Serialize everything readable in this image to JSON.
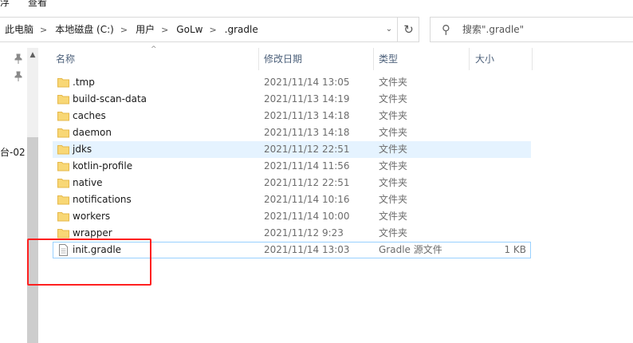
{
  "ribbon": {
    "items": [
      "浮",
      "查看"
    ]
  },
  "address_bar": {
    "crumbs": [
      "此电脑",
      "本地磁盘 (C:)",
      "用户",
      "GoLw",
      ".gradle"
    ],
    "separator": ">",
    "dropdown_glyph": "⌄",
    "refresh_glyph": "↻"
  },
  "search": {
    "placeholder": "搜索\".gradle\""
  },
  "nav_pane": {
    "partial_label": "台-02"
  },
  "columns": {
    "name": "名称",
    "date": "修改日期",
    "type": "类型",
    "size": "大小"
  },
  "files": [
    {
      "name": ".tmp",
      "date": "2021/11/14 13:05",
      "type": "文件夹",
      "size": "",
      "kind": "folder"
    },
    {
      "name": "build-scan-data",
      "date": "2021/11/13 14:19",
      "type": "文件夹",
      "size": "",
      "kind": "folder"
    },
    {
      "name": "caches",
      "date": "2021/11/13 14:18",
      "type": "文件夹",
      "size": "",
      "kind": "folder"
    },
    {
      "name": "daemon",
      "date": "2021/11/13 14:18",
      "type": "文件夹",
      "size": "",
      "kind": "folder"
    },
    {
      "name": "jdks",
      "date": "2021/11/12 22:51",
      "type": "文件夹",
      "size": "",
      "kind": "folder",
      "selected": true
    },
    {
      "name": "kotlin-profile",
      "date": "2021/11/14 11:56",
      "type": "文件夹",
      "size": "",
      "kind": "folder"
    },
    {
      "name": "native",
      "date": "2021/11/12 22:51",
      "type": "文件夹",
      "size": "",
      "kind": "folder"
    },
    {
      "name": "notifications",
      "date": "2021/11/14 10:16",
      "type": "文件夹",
      "size": "",
      "kind": "folder"
    },
    {
      "name": "workers",
      "date": "2021/11/14 10:00",
      "type": "文件夹",
      "size": "",
      "kind": "folder"
    },
    {
      "name": "wrapper",
      "date": "2021/11/12 9:23",
      "type": "文件夹",
      "size": "",
      "kind": "folder"
    },
    {
      "name": "init.gradle",
      "date": "2021/11/14 13:03",
      "type": "Gradle 源文件",
      "size": "1 KB",
      "kind": "file",
      "focused": true
    }
  ],
  "colors": {
    "folder": "#f8d775",
    "folder_edge": "#e6b84a",
    "selection": "#e5f3ff",
    "annotation": "#ff2020"
  }
}
